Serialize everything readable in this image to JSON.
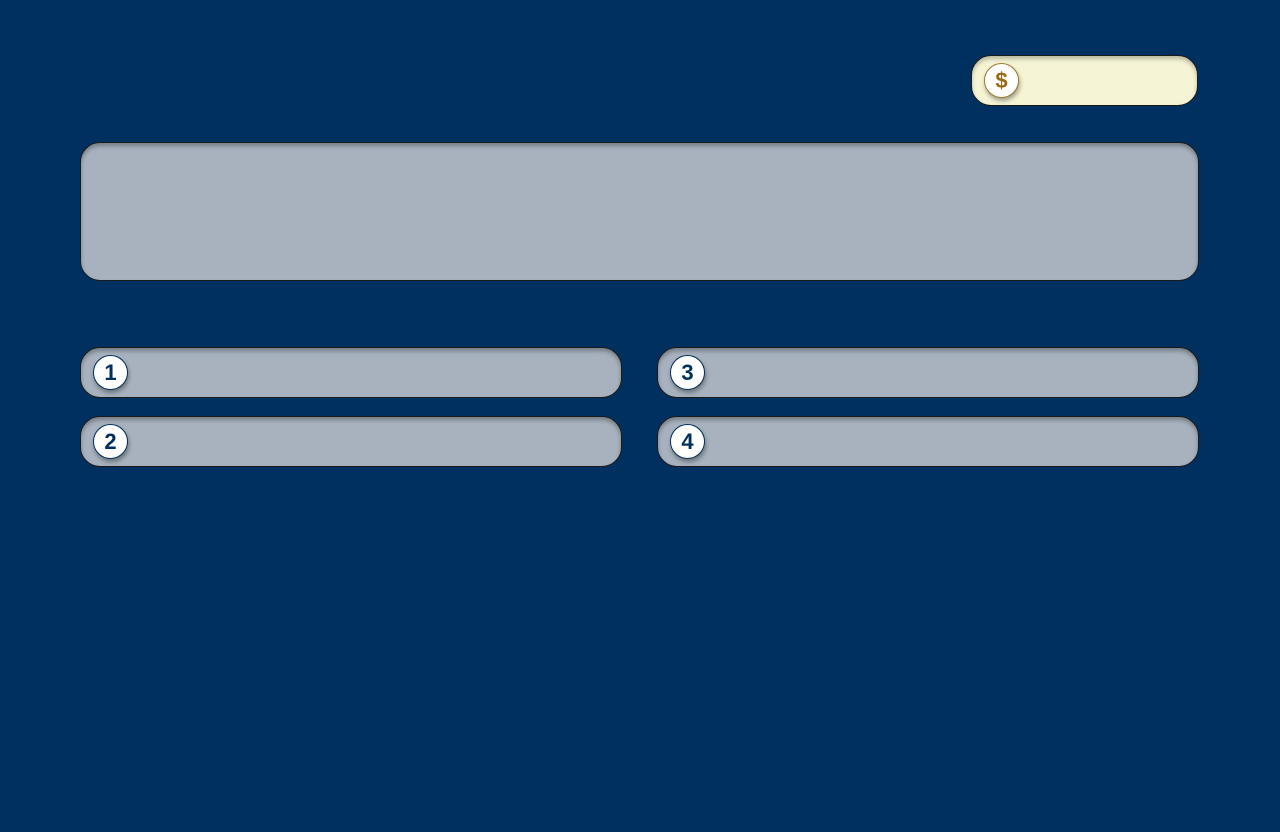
{
  "colors": {
    "background": "#00305f",
    "panel": "#a7b2be",
    "score_panel": "#f5f4d5",
    "coin_symbol": "#9a6a12",
    "badge_text": "#00305f"
  },
  "score": {
    "icon": "dollar-coin-icon",
    "symbol": "$",
    "value": ""
  },
  "question": {
    "text": ""
  },
  "answers": [
    {
      "number": "1",
      "text": ""
    },
    {
      "number": "2",
      "text": ""
    },
    {
      "number": "3",
      "text": ""
    },
    {
      "number": "4",
      "text": ""
    }
  ]
}
